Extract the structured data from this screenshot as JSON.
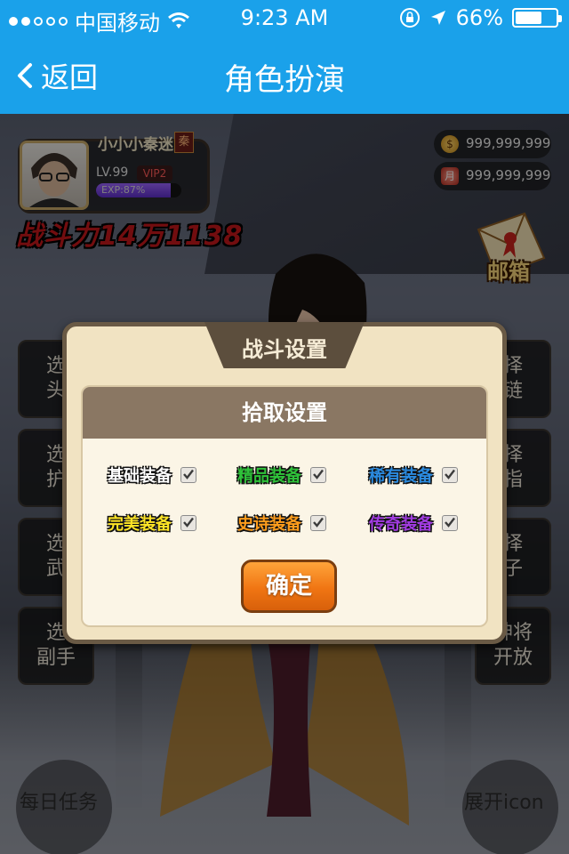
{
  "status_bar": {
    "carrier": "中国移动",
    "time": "9:23 AM",
    "battery": "66%",
    "battery_level": 0.66,
    "signal_bars_filled": 2
  },
  "nav": {
    "back_label": "返回",
    "title": "角色扮演"
  },
  "player": {
    "name": "小小小秦迷",
    "faction": "秦",
    "level": "LV.99",
    "vip": "VIP2",
    "exp_label": "EXP:87%",
    "exp_fraction": 0.87,
    "combat_power": "战斗力14万1138"
  },
  "currencies": [
    {
      "icon": "gold-coin-icon",
      "symbol": "$",
      "value": "999,999,999"
    },
    {
      "icon": "yueka-icon",
      "symbol": "月",
      "value": "999,999,999"
    }
  ],
  "mail_label": "邮箱",
  "slots_left": [
    {
      "line1": "选",
      "line2": "头"
    },
    {
      "line1": "选",
      "line2": "护"
    },
    {
      "line1": "选",
      "line2": "武"
    },
    {
      "line1": "选",
      "line2": "副手"
    }
  ],
  "slots_right": [
    {
      "line1": "择",
      "line2": "链"
    },
    {
      "line1": "择",
      "line2": "指"
    },
    {
      "line1": "择",
      "line2": "子"
    },
    {
      "line1": "神将",
      "line2": "开放"
    }
  ],
  "daily_tasks_label": "每日任务",
  "expand_label": "展开icon",
  "dialog": {
    "title": "战斗设置",
    "section_title": "拾取设置",
    "options": [
      {
        "label": "基础装备",
        "color": "#ffffff",
        "checked": true
      },
      {
        "label": "精品装备",
        "color": "#2fc33a",
        "checked": true
      },
      {
        "label": "稀有装备",
        "color": "#2b8be0",
        "checked": true
      },
      {
        "label": "完美装备",
        "color": "#ffe526",
        "checked": true
      },
      {
        "label": "史诗装备",
        "color": "#ff9d1c",
        "checked": true
      },
      {
        "label": "传奇装备",
        "color": "#a23ce2",
        "checked": true
      }
    ],
    "confirm_label": "确定"
  }
}
